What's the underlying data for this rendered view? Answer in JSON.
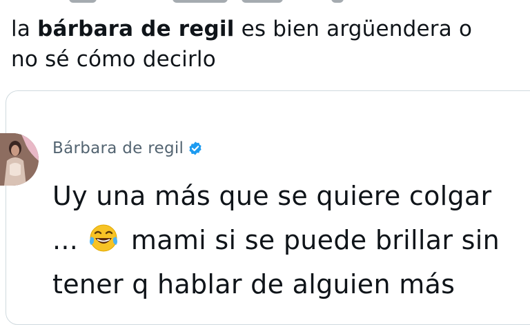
{
  "tweet": {
    "text_part1": "la ",
    "text_bold": "bárbara de regil",
    "text_part2": " es bien argüendera o",
    "text_line2": "no sé cómo decirlo"
  },
  "quoted": {
    "author_name": "Bárbara de regil",
    "verified_icon": "verified-badge-icon",
    "line1": "Uy una más que se quiere colgar",
    "line2_prefix": "... ",
    "emoji_icon": "face-with-tears-of-joy-icon",
    "line2_suffix": " mami si se puede brillar sin",
    "line3": "tener q hablar de alguien más"
  },
  "colors": {
    "text": "#0f1419",
    "muted": "#536471",
    "verified": "#1d9bf0",
    "border": "#cfd9de"
  }
}
